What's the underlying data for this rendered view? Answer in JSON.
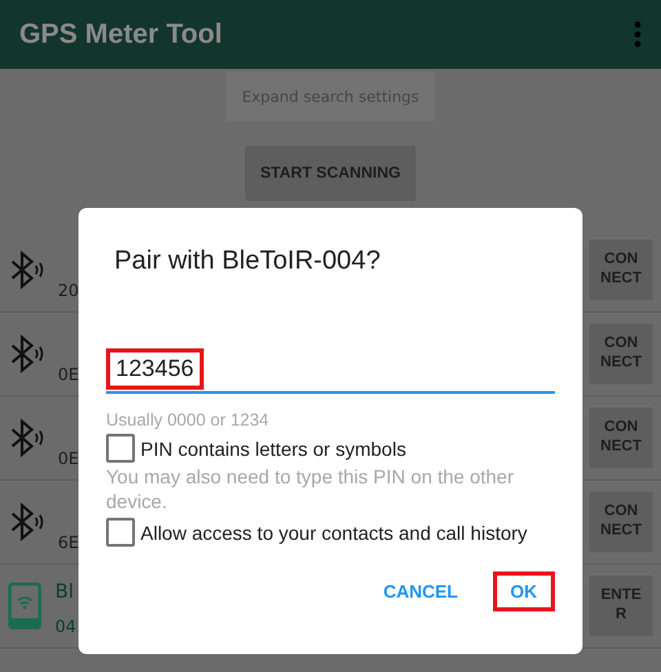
{
  "app_bar": {
    "title": "GPS Meter Tool"
  },
  "expand_button": "Expand search settings",
  "scan_button": "START SCANNING",
  "devices": [
    {
      "kind": "bluetooth",
      "address": "20",
      "action": "CON\nNECT"
    },
    {
      "kind": "bluetooth",
      "address": "0E",
      "action": "CON\nNECT"
    },
    {
      "kind": "bluetooth",
      "address": "0E",
      "action": "CON\nNECT"
    },
    {
      "kind": "bluetooth",
      "address": "6E",
      "action": "CON\nNECT"
    },
    {
      "kind": "phone",
      "name": "Bl",
      "address": "04",
      "action": "ENTE\nR"
    }
  ],
  "dialog": {
    "title": "Pair with BleToIR-004?",
    "pin": {
      "value": "123456",
      "highlighted": true
    },
    "hint": "Usually 0000 or 1234",
    "options": [
      {
        "label": "PIN contains letters or symbols",
        "checked": false
      }
    ],
    "note": "You may also need to type this PIN on the other device.",
    "options2": [
      {
        "label": "Allow access to your contacts and call history",
        "checked": false
      }
    ],
    "buttons": [
      {
        "label": "CANCEL",
        "highlighted": false
      },
      {
        "label": "OK",
        "highlighted": true
      }
    ]
  }
}
